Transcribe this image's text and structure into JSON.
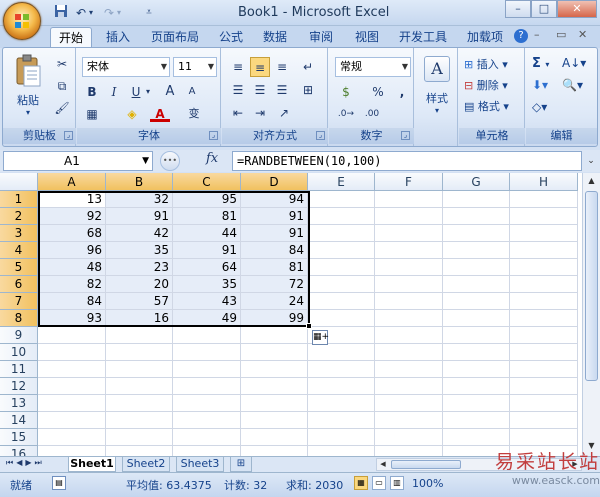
{
  "window": {
    "title": "Book1 - Microsoft Excel",
    "min_label": "–",
    "restore_label": "□",
    "close_label": "✕"
  },
  "qat": {
    "save_icon": "save-icon",
    "undo_icon": "undo-icon",
    "redo_icon": "redo-icon",
    "customize_icon": "dropdown-icon"
  },
  "tabs": [
    {
      "label": "开始",
      "active": true
    },
    {
      "label": "插入"
    },
    {
      "label": "页面布局"
    },
    {
      "label": "公式"
    },
    {
      "label": "数据"
    },
    {
      "label": "审阅"
    },
    {
      "label": "视图"
    },
    {
      "label": "开发工具"
    },
    {
      "label": "加载项"
    }
  ],
  "ribbon": {
    "clipboard": {
      "paste_label": "粘贴",
      "group_label": "剪贴板"
    },
    "font": {
      "name": "宋体",
      "size": "11",
      "group_label": "字体",
      "bold": "B",
      "italic": "I",
      "underline": "U",
      "grow": "A",
      "shrink": "A",
      "phonetic": "变"
    },
    "alignment": {
      "group_label": "对齐方式"
    },
    "number": {
      "format": "常规",
      "group_label": "数字",
      "percent": "%",
      "comma": ","
    },
    "styles": {
      "label": "样式"
    },
    "cells": {
      "insert": "插入",
      "delete": "删除",
      "format": "格式",
      "group_label": "单元格"
    },
    "editing": {
      "group_label": "编辑",
      "sum": "Σ"
    }
  },
  "formula_bar": {
    "name_box": "A1",
    "fx": "fx",
    "formula": "=RANDBETWEEN(10,100)"
  },
  "sheet": {
    "columns": [
      "A",
      "B",
      "C",
      "D",
      "E",
      "F",
      "G",
      "H"
    ],
    "rows": [
      "1",
      "2",
      "3",
      "4",
      "5",
      "6",
      "7",
      "8",
      "9",
      "10",
      "11",
      "12",
      "13",
      "14",
      "15",
      "16"
    ],
    "data": [
      [
        13,
        32,
        95,
        94
      ],
      [
        92,
        91,
        81,
        91
      ],
      [
        68,
        42,
        44,
        91
      ],
      [
        96,
        35,
        91,
        84
      ],
      [
        48,
        23,
        64,
        81
      ],
      [
        82,
        20,
        35,
        72
      ],
      [
        84,
        57,
        43,
        24
      ],
      [
        93,
        16,
        49,
        99
      ]
    ]
  },
  "sheet_tabs": [
    "Sheet1",
    "Sheet2",
    "Sheet3"
  ],
  "status": {
    "mode": "就绪",
    "average": "平均值: 63.4375",
    "count": "计数: 32",
    "sum": "求和: 2030",
    "zoom": "100%"
  },
  "watermark": {
    "line1": "易采站长站",
    "line2": "www.easck.com"
  }
}
